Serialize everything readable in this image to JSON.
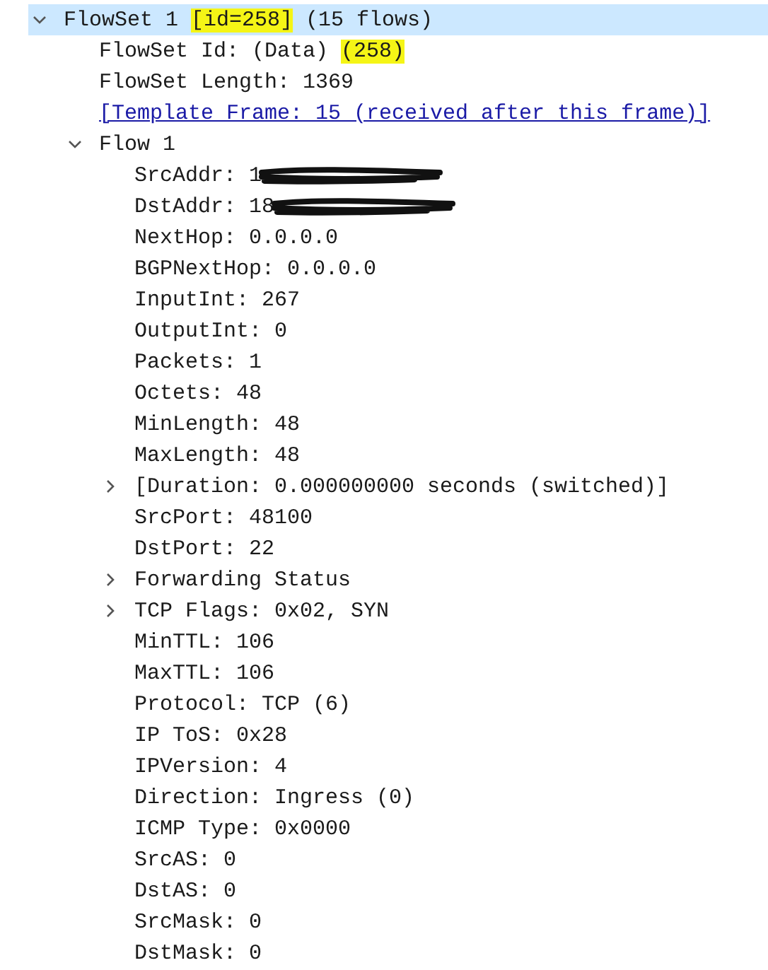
{
  "tree": [
    {
      "segments": [
        {
          "text": "FlowSet 1 ",
          "highlighted": false
        },
        {
          "text": "[id=258]",
          "highlighted": true
        },
        {
          "text": " (15 flows)",
          "highlighted": false
        }
      ],
      "kind": "field",
      "selected": true,
      "expanded": true,
      "children": [
        {
          "segments": [
            {
              "text": "FlowSet Id: (Data) ",
              "highlighted": false
            },
            {
              "text": "(258)",
              "highlighted": true
            }
          ],
          "kind": "field",
          "selected": false
        },
        {
          "text": "FlowSet Length: 1369",
          "kind": "field",
          "selected": false
        },
        {
          "text": "[Template Frame: 15 (received after this frame)]",
          "kind": "link",
          "selected": false
        },
        {
          "text": "Flow 1",
          "kind": "field",
          "selected": false,
          "expanded": true,
          "children": [
            {
              "text": "SrcAddr: 1",
              "kind": "redacted",
              "selected": false
            },
            {
              "text": "DstAddr: 18",
              "kind": "redacted",
              "selected": false
            },
            {
              "text": "NextHop: 0.0.0.0",
              "kind": "field",
              "selected": false
            },
            {
              "text": "BGPNextHop: 0.0.0.0",
              "kind": "field",
              "selected": false
            },
            {
              "text": "InputInt: 267",
              "kind": "field",
              "selected": false
            },
            {
              "text": "OutputInt: 0",
              "kind": "field",
              "selected": false
            },
            {
              "text": "Packets: 1",
              "kind": "field",
              "selected": false
            },
            {
              "text": "Octets: 48",
              "kind": "field",
              "selected": false
            },
            {
              "text": "MinLength: 48",
              "kind": "field",
              "selected": false
            },
            {
              "text": "MaxLength: 48",
              "kind": "field",
              "selected": false
            },
            {
              "text": "[Duration: 0.000000000 seconds (switched)]",
              "kind": "field",
              "selected": false,
              "expanded": false
            },
            {
              "text": "SrcPort: 48100",
              "kind": "field",
              "selected": false
            },
            {
              "text": "DstPort: 22",
              "kind": "field",
              "selected": false
            },
            {
              "text": "Forwarding Status",
              "kind": "field",
              "selected": false,
              "expanded": false
            },
            {
              "text": "TCP Flags: 0x02, SYN",
              "kind": "field",
              "selected": false,
              "expanded": false
            },
            {
              "text": "MinTTL: 106",
              "kind": "field",
              "selected": false
            },
            {
              "text": "MaxTTL: 106",
              "kind": "field",
              "selected": false
            },
            {
              "text": "Protocol: TCP (6)",
              "kind": "field",
              "selected": false
            },
            {
              "text": "IP ToS: 0x28",
              "kind": "field",
              "selected": false
            },
            {
              "text": "IPVersion: 4",
              "kind": "field",
              "selected": false
            },
            {
              "text": "Direction: Ingress (0)",
              "kind": "field",
              "selected": false
            },
            {
              "text": "ICMP Type: 0x0000",
              "kind": "field",
              "selected": false
            },
            {
              "text": "SrcAS: 0",
              "kind": "field",
              "selected": false
            },
            {
              "text": "DstAS: 0",
              "kind": "field",
              "selected": false
            },
            {
              "text": "SrcMask: 0",
              "kind": "field",
              "selected": false
            },
            {
              "text": "DstMask: 0",
              "kind": "field",
              "selected": false
            }
          ]
        }
      ]
    }
  ]
}
